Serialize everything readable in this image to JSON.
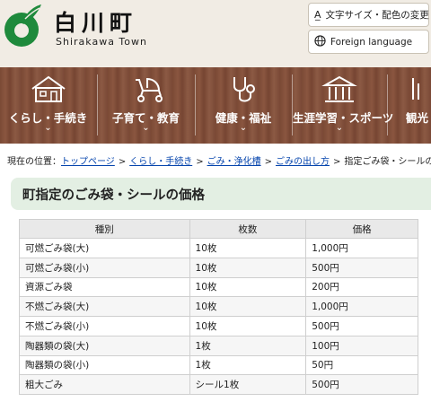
{
  "header": {
    "site_name": "白川町",
    "site_sub": "Shirakawa Town",
    "font_color_button": "文字サイズ・配色の変更",
    "language_button": "Foreign language"
  },
  "nav": {
    "items": [
      {
        "label": "くらし・手続き",
        "icon": "house-icon"
      },
      {
        "label": "子育て・教育",
        "icon": "stroller-icon"
      },
      {
        "label": "健康・福祉",
        "icon": "stethoscope-icon"
      },
      {
        "label": "生涯学習・スポーツ",
        "icon": "building-icon"
      },
      {
        "label": "観光",
        "icon": "sightseeing-icon"
      }
    ]
  },
  "breadcrumb": {
    "prefix": "現在の位置：",
    "links": [
      "トップページ",
      "くらし・手続き",
      "ごみ・浄化槽",
      "ごみの出し方"
    ],
    "current": "指定ごみ袋・シールの価格"
  },
  "page": {
    "title": "町指定のごみ袋・シールの価格"
  },
  "table": {
    "headers": [
      "種別",
      "枚数",
      "価格"
    ],
    "rows": [
      [
        "可燃ごみ袋(大)",
        "10枚",
        "1,000円"
      ],
      [
        "可燃ごみ袋(小)",
        "10枚",
        "500円"
      ],
      [
        "資源ごみ袋",
        "10枚",
        "200円"
      ],
      [
        "不燃ごみ袋(大)",
        "10枚",
        "1,000円"
      ],
      [
        "不燃ごみ袋(小)",
        "10枚",
        "500円"
      ],
      [
        "陶器類の袋(大)",
        "1枚",
        "100円"
      ],
      [
        "陶器類の袋(小)",
        "1枚",
        "50円"
      ],
      [
        "粗大ごみ",
        "シール1枚",
        "500円"
      ]
    ]
  },
  "colors": {
    "logo_green": "#1f8a3c",
    "nav_brown": "#7b4a35",
    "title_bg": "#e3efe3",
    "link_blue": "#0645ad"
  }
}
